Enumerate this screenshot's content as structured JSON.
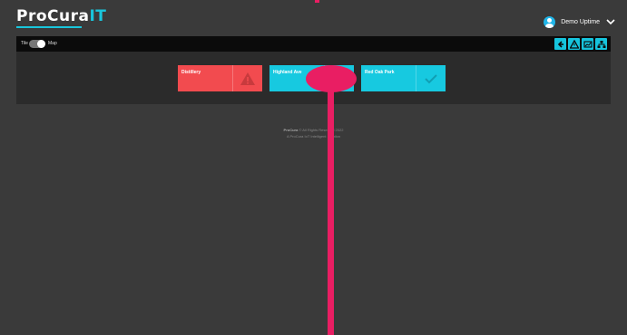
{
  "app": {
    "logo_main": "ProCura",
    "logo_suffix": "IT"
  },
  "user": {
    "name": "Demo Uptime"
  },
  "toolbar": {
    "tile_label": "Tile",
    "map_label": "Map",
    "view_mode": "map",
    "buttons": [
      "back-icon",
      "alert-icon",
      "chart-icon",
      "network-icon"
    ]
  },
  "sites": [
    {
      "name": "Distillery",
      "status": "alarm",
      "color": "#f24b4f"
    },
    {
      "name": "Highland Ave",
      "status": "ok",
      "color": "#17c9e0"
    },
    {
      "name": "Red Oak Park",
      "status": "ok",
      "color": "#17c9e0"
    }
  ],
  "footer": {
    "brand": "ProCura",
    "copyright": "© All Rights Reserved 2022",
    "line2": "A ProCura IoT Intelligent Solution"
  },
  "colors": {
    "accent": "#17c9e0",
    "alarm": "#f24b4f",
    "annotation": "#e91e63"
  }
}
